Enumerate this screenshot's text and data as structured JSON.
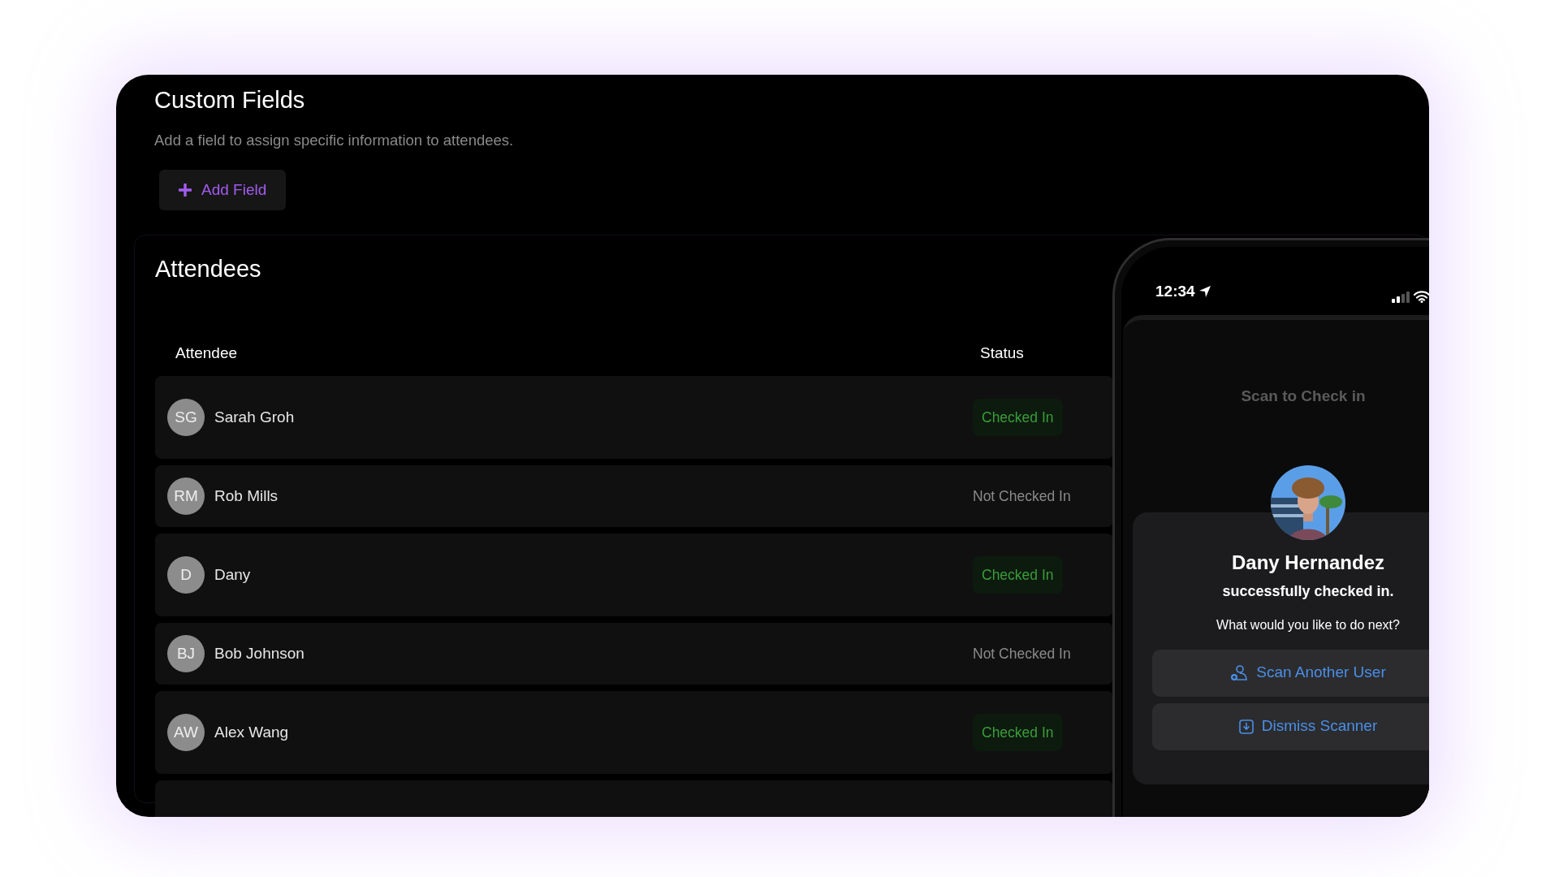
{
  "custom_fields": {
    "title": "Custom Fields",
    "description": "Add a field to assign specific information to attendees.",
    "add_button": "Add Field"
  },
  "attendees": {
    "title": "Attendees",
    "columns": [
      "Attendee",
      "Status"
    ],
    "rows": [
      {
        "initials": "SG",
        "name": "Sarah Groh",
        "status": "Checked In",
        "checked_in": true
      },
      {
        "initials": "RM",
        "name": "Rob Mills",
        "status": "Not Checked In",
        "checked_in": false
      },
      {
        "initials": "D",
        "name": "Dany",
        "status": "Checked In",
        "checked_in": true
      },
      {
        "initials": "BJ",
        "name": "Bob Johnson",
        "status": "Not Checked In",
        "checked_in": false
      },
      {
        "initials": "AW",
        "name": "Alex Wang",
        "status": "Checked In",
        "checked_in": true
      }
    ]
  },
  "phone": {
    "time": "12:34",
    "background_title": "Scan to Check in",
    "dialog": {
      "name": "Dany Hernandez",
      "message": "successfully checked in.",
      "prompt": "What would you like to do next?",
      "actions": [
        {
          "label": "Scan Another User",
          "kind": "scan"
        },
        {
          "label": "Dismiss Scanner",
          "kind": "dismiss"
        }
      ]
    }
  }
}
